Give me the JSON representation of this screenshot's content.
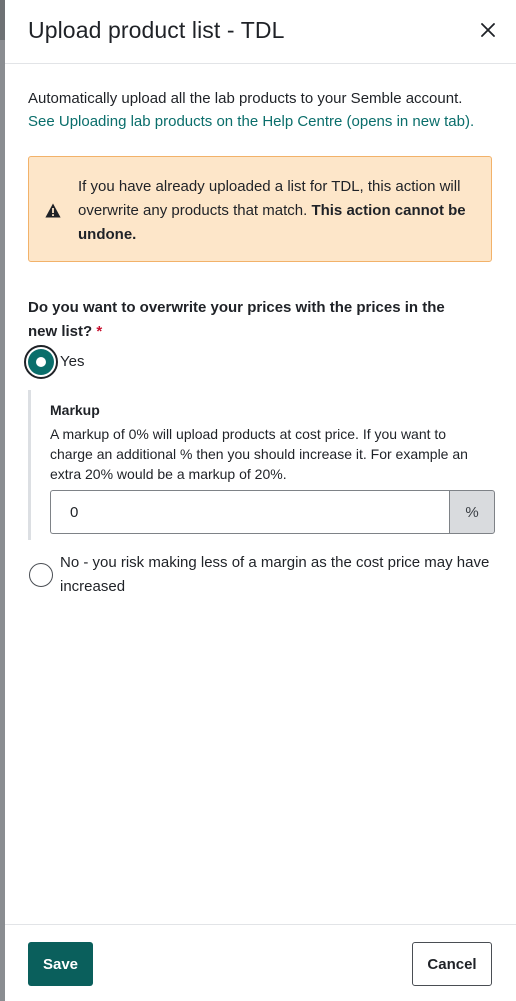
{
  "dialog": {
    "title": "Upload product list - TDL",
    "close_icon": "close-icon"
  },
  "intro": {
    "text": "Automatically upload all the lab products to your Semble account.",
    "link": "See Uploading lab products on the Help Centre (opens in new tab)."
  },
  "warning": {
    "icon": "warning-triangle-icon",
    "text": "If you have already uploaded a list for TDL, this action will overwrite any products that match. ",
    "bold_text": "This action cannot be undone."
  },
  "question": {
    "label": "Do you want to overwrite your prices with the prices in the new list?",
    "required_marker": "*",
    "selected": "yes",
    "options": {
      "yes": {
        "label": "Yes"
      },
      "no": {
        "label": "No - you risk making less of a margin as the cost price may have increased"
      }
    }
  },
  "markup": {
    "title": "Markup",
    "description": "A markup of 0% will upload products at cost price. If you want to charge an additional % then you should increase it. For example an extra 20% would be a markup of 20%.",
    "value": "0",
    "suffix": "%"
  },
  "footer": {
    "save_label": "Save",
    "cancel_label": "Cancel"
  },
  "colors": {
    "accent": "#0a6e6b",
    "primary_button": "#0a5f5c",
    "warning_bg": "#fde6c9",
    "warning_border": "#f2b26a",
    "required": "#c8102e"
  }
}
